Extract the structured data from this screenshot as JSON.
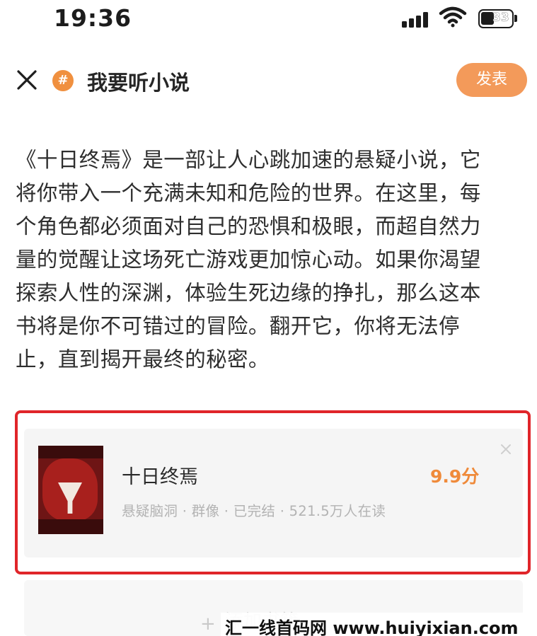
{
  "status_bar": {
    "time": "19:36",
    "battery": "33"
  },
  "header": {
    "topic_icon": "#",
    "title": "我要听小说",
    "publish_label": "发表"
  },
  "post": {
    "lines": [
      "《十日终焉》是一部让人心跳加速的悬疑小说，它",
      "将你带入一个充满未知和危险的世界。在这里，每",
      "个角色都必须面对自己的恐惧和极眼，而超自然力",
      "量的觉醒让这场死亡游戏更加惊心动。如果你渴望",
      "探索人性的深渊，体验生死边缘的挣扎，那么这本",
      "书将是你不可错过的冒险。翻开它，你将无法停",
      "止，直到揭开最终的秘密。"
    ]
  },
  "book_card": {
    "title": "十日终焉",
    "score": "9.9分",
    "meta": "悬疑脑洞 · 群像 · 已完结 · 521.5万人在读"
  },
  "add_area": {
    "label": "添加书籍"
  },
  "watermark": "汇一线首码网 www.huiyixian.com",
  "colors": {
    "accent": "#f39a5a",
    "score": "#ef8a3a",
    "highlight_border": "#e0252a"
  }
}
